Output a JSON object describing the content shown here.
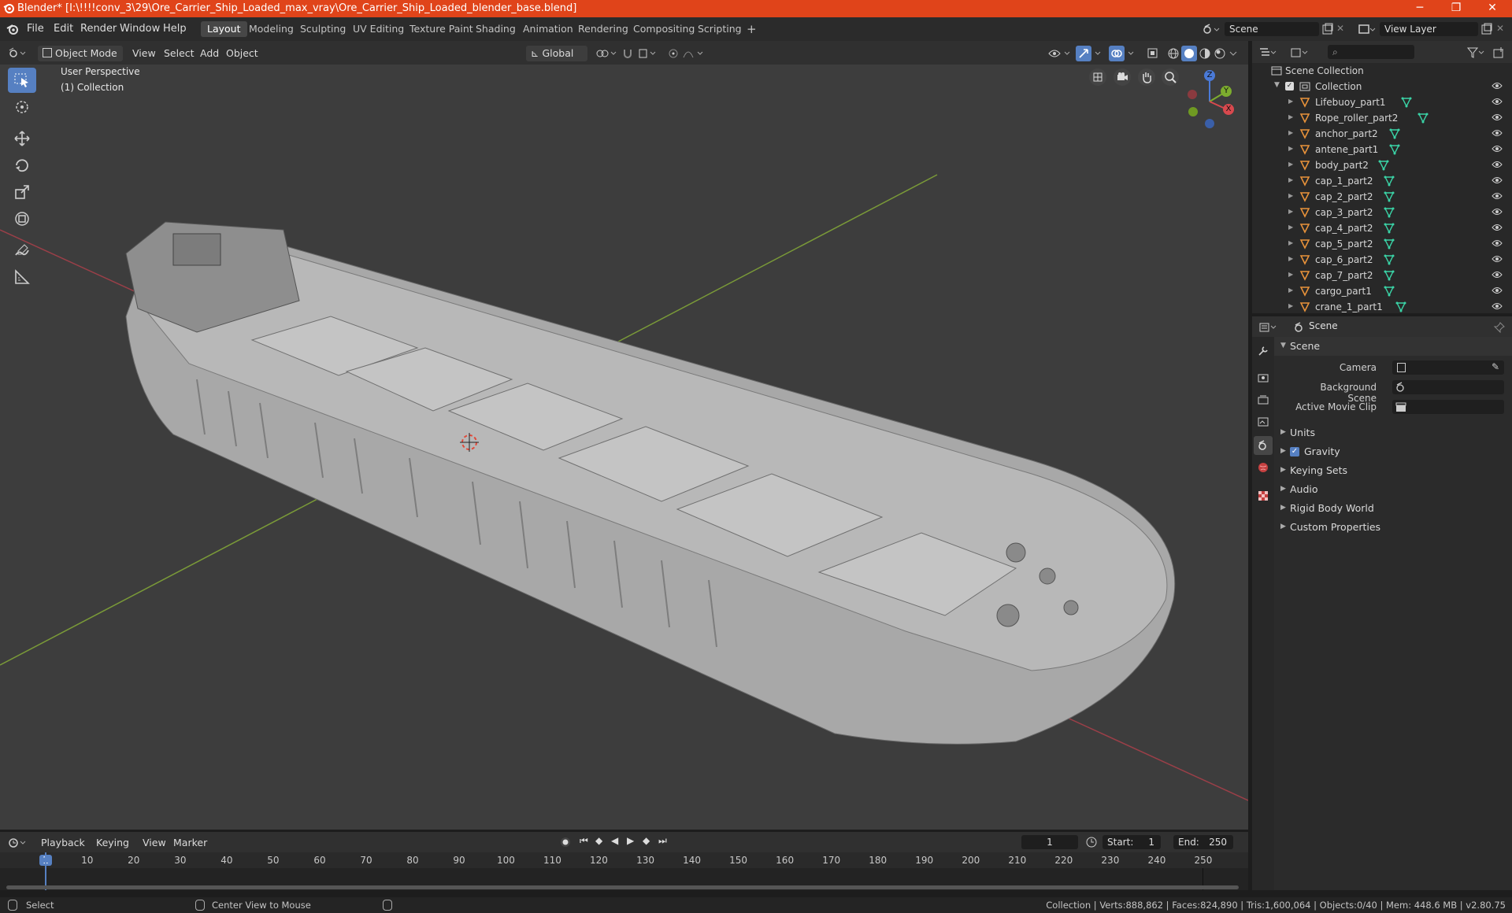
{
  "window": {
    "title": "Blender* [I:\\!!!!conv_3\\29\\Ore_Carrier_Ship_Loaded_max_vray\\Ore_Carrier_Ship_Loaded_blender_base.blend]",
    "minimize": "─",
    "maximize": "❐",
    "close": "✕"
  },
  "menus": [
    "File",
    "Edit",
    "Render",
    "Window",
    "Help"
  ],
  "workspaces": [
    "Layout",
    "Modeling",
    "Sculpting",
    "UV Editing",
    "Texture Paint",
    "Shading",
    "Animation",
    "Rendering",
    "Compositing",
    "Scripting"
  ],
  "add_workspace": "+",
  "scene_field": "Scene",
  "view_layer_field": "View Layer",
  "viewport_header": {
    "mode": "Object Mode",
    "menus": [
      "View",
      "Select",
      "Add",
      "Object"
    ],
    "orientation": "Global"
  },
  "viewport": {
    "perspective": "User Perspective",
    "collection": "(1) Collection",
    "gizmo": {
      "z": "Z",
      "y": "Y",
      "x": "X"
    }
  },
  "outliner": {
    "root": "Scene Collection",
    "collection": "Collection",
    "items": [
      "Lifebuoy_part1",
      "Rope_roller_part2",
      "anchor_part2",
      "antene_part1",
      "body_part2",
      "cap_1_part2",
      "cap_2_part2",
      "cap_3_part2",
      "cap_4_part2",
      "cap_5_part2",
      "cap_6_part2",
      "cap_7_part2",
      "cargo_part1",
      "crane_1_part1"
    ]
  },
  "properties": {
    "context": "Scene",
    "section": "Scene",
    "camera_label": "Camera",
    "background_scene_label": "Background Scene",
    "movie_clip_label": "Active Movie Clip",
    "panels": [
      "Units",
      "Gravity",
      "Keying Sets",
      "Audio",
      "Rigid Body World",
      "Custom Properties"
    ]
  },
  "timeline": {
    "menus": [
      "Playback",
      "Keying",
      "View",
      "Marker"
    ],
    "current_frame": "1",
    "start_label": "Start:",
    "start": "1",
    "end_label": "End:",
    "end": "250",
    "ruler": [
      "1",
      "10",
      "20",
      "30",
      "40",
      "50",
      "60",
      "70",
      "80",
      "90",
      "100",
      "110",
      "120",
      "130",
      "140",
      "150",
      "160",
      "170",
      "180",
      "190",
      "200",
      "210",
      "220",
      "230",
      "240",
      "250"
    ]
  },
  "status": {
    "select": "Select",
    "center": "Center View to Mouse",
    "stats": "Collection | Verts:888,862 | Faces:824,890 | Tris:1,600,064 | Objects:0/40 | Mem: 448.6 MB | v2.80.75"
  }
}
